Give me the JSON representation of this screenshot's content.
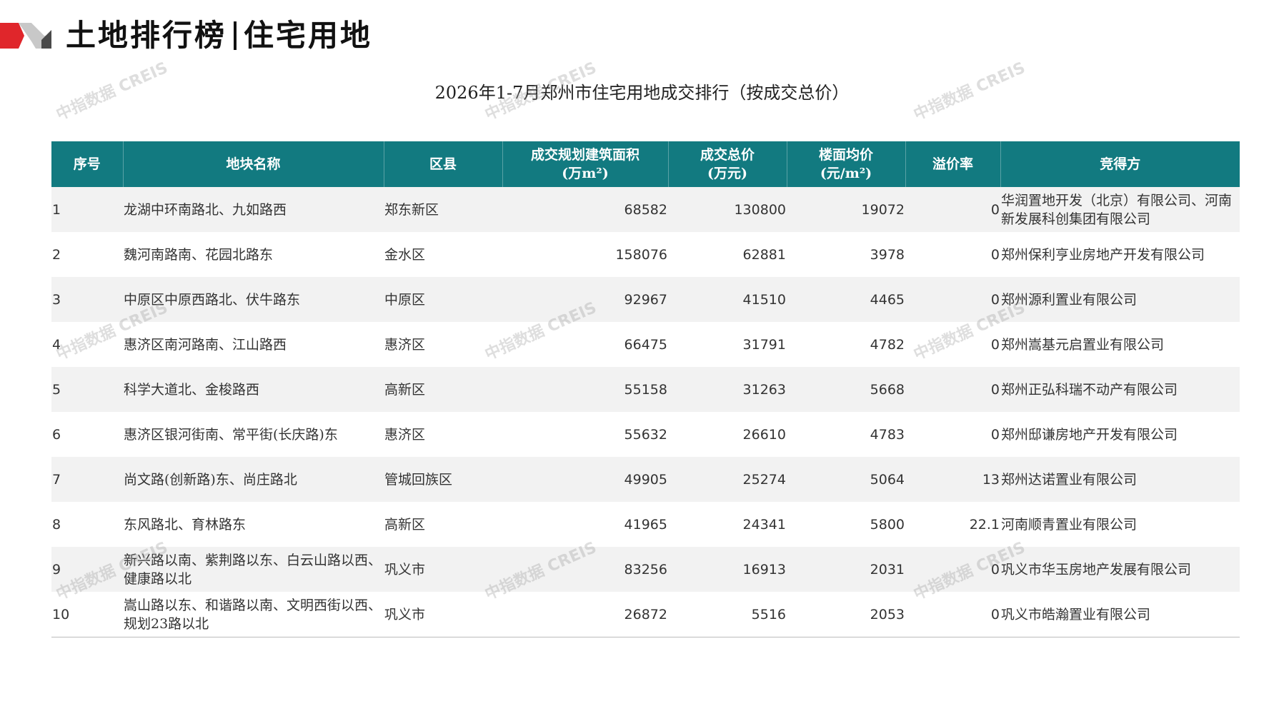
{
  "header": {
    "title_left": "土地排行榜",
    "title_right": "住宅用地"
  },
  "colors": {
    "accent_red": "#e0262b",
    "header_teal": "#127a80",
    "value_red": "#c00000",
    "stripe_gray": "#f2f2f2"
  },
  "table_title": "2026年1-7月郑州市住宅用地成交排行（按成交总价）",
  "watermark": "中指数据 CREIS",
  "table": {
    "columns": [
      {
        "label": "序号",
        "unit": ""
      },
      {
        "label": "地块名称",
        "unit": ""
      },
      {
        "label": "区县",
        "unit": ""
      },
      {
        "label": "成交规划建筑面积",
        "unit": "(万m²)"
      },
      {
        "label": "成交总价",
        "unit": "(万元)"
      },
      {
        "label": "楼面均价",
        "unit": "(元/m²)"
      },
      {
        "label": "溢价率",
        "unit": ""
      },
      {
        "label": "竞得方",
        "unit": ""
      }
    ],
    "rows": [
      {
        "rank": "1",
        "parcel": "龙湖中环南路北、九如路西",
        "district": "郑东新区",
        "area": "68582",
        "total_price": "130800",
        "unit_price": "19072",
        "premium": "0",
        "winner": "华润置地开发（北京）有限公司、河南新发展科创集团有限公司"
      },
      {
        "rank": "2",
        "parcel": "魏河南路南、花园北路东",
        "district": "金水区",
        "area": "158076",
        "total_price": "62881",
        "unit_price": "3978",
        "premium": "0",
        "winner": "郑州保利亨业房地产开发有限公司"
      },
      {
        "rank": "3",
        "parcel": "中原区中原西路北、伏牛路东",
        "district": "中原区",
        "area": "92967",
        "total_price": "41510",
        "unit_price": "4465",
        "premium": "0",
        "winner": "郑州源利置业有限公司"
      },
      {
        "rank": "4",
        "parcel": "惠济区南河路南、江山路西",
        "district": "惠济区",
        "area": "66475",
        "total_price": "31791",
        "unit_price": "4782",
        "premium": "0",
        "winner": "郑州嵩基元启置业有限公司"
      },
      {
        "rank": "5",
        "parcel": "科学大道北、金梭路西",
        "district": "高新区",
        "area": "55158",
        "total_price": "31263",
        "unit_price": "5668",
        "premium": "0",
        "winner": "郑州正弘科瑞不动产有限公司"
      },
      {
        "rank": "6",
        "parcel": "惠济区银河街南、常平街(长庆路)东",
        "district": "惠济区",
        "area": "55632",
        "total_price": "26610",
        "unit_price": "4783",
        "premium": "0",
        "winner": "郑州邸谦房地产开发有限公司"
      },
      {
        "rank": "7",
        "parcel": "尚文路(创新路)东、尚庄路北",
        "district": "管城回族区",
        "area": "49905",
        "total_price": "25274",
        "unit_price": "5064",
        "premium": "13",
        "winner": "郑州达诺置业有限公司"
      },
      {
        "rank": "8",
        "parcel": "东风路北、育林路东",
        "district": "高新区",
        "area": "41965",
        "total_price": "24341",
        "unit_price": "5800",
        "premium": "22.1",
        "winner": "河南顺青置业有限公司"
      },
      {
        "rank": "9",
        "parcel": "新兴路以南、紫荆路以东、白云山路以西、健康路以北",
        "district": "巩义市",
        "area": "83256",
        "total_price": "16913",
        "unit_price": "2031",
        "premium": "0",
        "winner": "巩义市华玉房地产发展有限公司"
      },
      {
        "rank": "10",
        "parcel": "嵩山路以东、和谐路以南、文明西街以西、规划23路以北",
        "district": "巩义市",
        "area": "26872",
        "total_price": "5516",
        "unit_price": "2053",
        "premium": "0",
        "winner": "巩义市皓瀚置业有限公司"
      }
    ]
  }
}
